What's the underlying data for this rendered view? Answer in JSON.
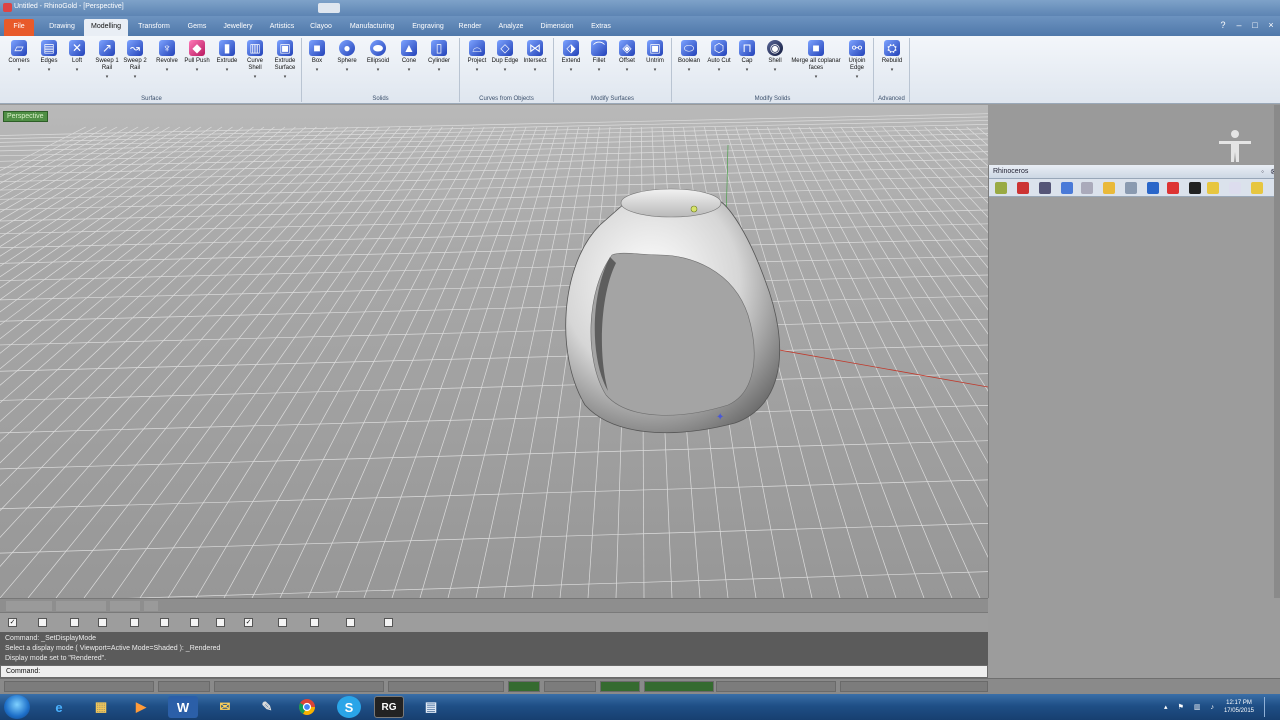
{
  "window": {
    "title": "Untitled - RhinoGold - [Perspective]"
  },
  "ribbon_tabs": [
    "File",
    "Drawing",
    "Modelling",
    "Transform",
    "Gems",
    "Jewellery",
    "Artistics",
    "Clayoo",
    "Manufacturing",
    "Engraving",
    "Render",
    "Analyze",
    "Dimension",
    "Extras"
  ],
  "ribbon_groups": {
    "surface": {
      "label": "Surface",
      "tools": [
        "Corners",
        "Edges",
        "Loft",
        "Sweep 1 Rail",
        "Sweep 2 Rail",
        "Revolve",
        "Pull Push",
        "Extrude",
        "Curve Shell",
        "Extrude Surface"
      ]
    },
    "solids": {
      "label": "Solids",
      "tools": [
        "Box",
        "Sphere",
        "Ellipsoid",
        "Cone",
        "Cylinder"
      ]
    },
    "curves_from_objects": {
      "label": "Curves from Objects",
      "tools": [
        "Project",
        "Dup Edge",
        "Intersect"
      ]
    },
    "modify_surfaces": {
      "label": "Modify Surfaces",
      "tools": [
        "Extend",
        "Fillet",
        "Offset",
        "Untrim"
      ]
    },
    "modify_solids": {
      "label": "Modify Solids",
      "tools": [
        "Boolean",
        "Auto Cut",
        "Cap",
        "Shell",
        "Merge all coplanar faces",
        "Unjoin Edge"
      ]
    },
    "advanced": {
      "label": "Advanced",
      "tools": [
        "Rebuild"
      ]
    }
  },
  "viewport": {
    "label": "Perspective"
  },
  "side_panel": {
    "title": "Rhinoceros"
  },
  "command": {
    "history": [
      "Command: _SetDisplayMode",
      "Select a display mode ( Viewport=Active  Mode=Shaded ): _Rendered",
      "Display mode set to \"Rendered\"."
    ],
    "prompt": "Command:"
  },
  "colors": {
    "ribbon_accent": "#4f78aa",
    "file_tab": "#e85a2a",
    "status_on": "#356b30",
    "viewport_bg": "#a8a8a8"
  },
  "taskbar": {
    "apps": [
      "ie-icon",
      "explorer-icon",
      "media-player-icon",
      "word-icon",
      "outlook-icon",
      "paint-icon",
      "chrome-icon",
      "skype-icon",
      "rhinogold-icon",
      "save-icon"
    ],
    "rhinogold_label": "RG",
    "skype_label": "S",
    "word_label": "W",
    "time": "12:17 PM",
    "date": "17/05/2015"
  }
}
